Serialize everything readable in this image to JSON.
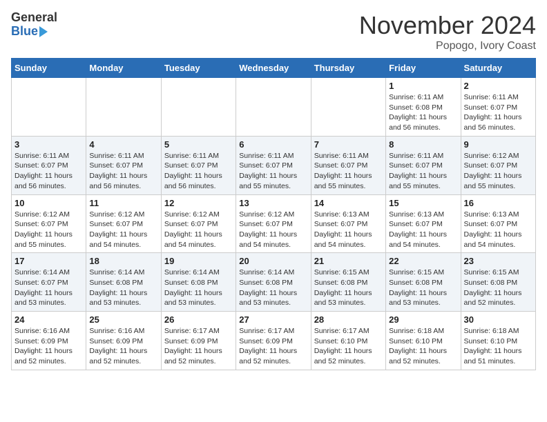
{
  "header": {
    "logo_general": "General",
    "logo_blue": "Blue",
    "month_title": "November 2024",
    "location": "Popogo, Ivory Coast"
  },
  "days_of_week": [
    "Sunday",
    "Monday",
    "Tuesday",
    "Wednesday",
    "Thursday",
    "Friday",
    "Saturday"
  ],
  "weeks": [
    [
      {
        "day": "",
        "info": ""
      },
      {
        "day": "",
        "info": ""
      },
      {
        "day": "",
        "info": ""
      },
      {
        "day": "",
        "info": ""
      },
      {
        "day": "",
        "info": ""
      },
      {
        "day": "1",
        "info": "Sunrise: 6:11 AM\nSunset: 6:08 PM\nDaylight: 11 hours and 56 minutes."
      },
      {
        "day": "2",
        "info": "Sunrise: 6:11 AM\nSunset: 6:07 PM\nDaylight: 11 hours and 56 minutes."
      }
    ],
    [
      {
        "day": "3",
        "info": "Sunrise: 6:11 AM\nSunset: 6:07 PM\nDaylight: 11 hours and 56 minutes."
      },
      {
        "day": "4",
        "info": "Sunrise: 6:11 AM\nSunset: 6:07 PM\nDaylight: 11 hours and 56 minutes."
      },
      {
        "day": "5",
        "info": "Sunrise: 6:11 AM\nSunset: 6:07 PM\nDaylight: 11 hours and 56 minutes."
      },
      {
        "day": "6",
        "info": "Sunrise: 6:11 AM\nSunset: 6:07 PM\nDaylight: 11 hours and 55 minutes."
      },
      {
        "day": "7",
        "info": "Sunrise: 6:11 AM\nSunset: 6:07 PM\nDaylight: 11 hours and 55 minutes."
      },
      {
        "day": "8",
        "info": "Sunrise: 6:11 AM\nSunset: 6:07 PM\nDaylight: 11 hours and 55 minutes."
      },
      {
        "day": "9",
        "info": "Sunrise: 6:12 AM\nSunset: 6:07 PM\nDaylight: 11 hours and 55 minutes."
      }
    ],
    [
      {
        "day": "10",
        "info": "Sunrise: 6:12 AM\nSunset: 6:07 PM\nDaylight: 11 hours and 55 minutes."
      },
      {
        "day": "11",
        "info": "Sunrise: 6:12 AM\nSunset: 6:07 PM\nDaylight: 11 hours and 54 minutes."
      },
      {
        "day": "12",
        "info": "Sunrise: 6:12 AM\nSunset: 6:07 PM\nDaylight: 11 hours and 54 minutes."
      },
      {
        "day": "13",
        "info": "Sunrise: 6:12 AM\nSunset: 6:07 PM\nDaylight: 11 hours and 54 minutes."
      },
      {
        "day": "14",
        "info": "Sunrise: 6:13 AM\nSunset: 6:07 PM\nDaylight: 11 hours and 54 minutes."
      },
      {
        "day": "15",
        "info": "Sunrise: 6:13 AM\nSunset: 6:07 PM\nDaylight: 11 hours and 54 minutes."
      },
      {
        "day": "16",
        "info": "Sunrise: 6:13 AM\nSunset: 6:07 PM\nDaylight: 11 hours and 54 minutes."
      }
    ],
    [
      {
        "day": "17",
        "info": "Sunrise: 6:14 AM\nSunset: 6:07 PM\nDaylight: 11 hours and 53 minutes."
      },
      {
        "day": "18",
        "info": "Sunrise: 6:14 AM\nSunset: 6:08 PM\nDaylight: 11 hours and 53 minutes."
      },
      {
        "day": "19",
        "info": "Sunrise: 6:14 AM\nSunset: 6:08 PM\nDaylight: 11 hours and 53 minutes."
      },
      {
        "day": "20",
        "info": "Sunrise: 6:14 AM\nSunset: 6:08 PM\nDaylight: 11 hours and 53 minutes."
      },
      {
        "day": "21",
        "info": "Sunrise: 6:15 AM\nSunset: 6:08 PM\nDaylight: 11 hours and 53 minutes."
      },
      {
        "day": "22",
        "info": "Sunrise: 6:15 AM\nSunset: 6:08 PM\nDaylight: 11 hours and 53 minutes."
      },
      {
        "day": "23",
        "info": "Sunrise: 6:15 AM\nSunset: 6:08 PM\nDaylight: 11 hours and 52 minutes."
      }
    ],
    [
      {
        "day": "24",
        "info": "Sunrise: 6:16 AM\nSunset: 6:09 PM\nDaylight: 11 hours and 52 minutes."
      },
      {
        "day": "25",
        "info": "Sunrise: 6:16 AM\nSunset: 6:09 PM\nDaylight: 11 hours and 52 minutes."
      },
      {
        "day": "26",
        "info": "Sunrise: 6:17 AM\nSunset: 6:09 PM\nDaylight: 11 hours and 52 minutes."
      },
      {
        "day": "27",
        "info": "Sunrise: 6:17 AM\nSunset: 6:09 PM\nDaylight: 11 hours and 52 minutes."
      },
      {
        "day": "28",
        "info": "Sunrise: 6:17 AM\nSunset: 6:10 PM\nDaylight: 11 hours and 52 minutes."
      },
      {
        "day": "29",
        "info": "Sunrise: 6:18 AM\nSunset: 6:10 PM\nDaylight: 11 hours and 52 minutes."
      },
      {
        "day": "30",
        "info": "Sunrise: 6:18 AM\nSunset: 6:10 PM\nDaylight: 11 hours and 51 minutes."
      }
    ]
  ]
}
